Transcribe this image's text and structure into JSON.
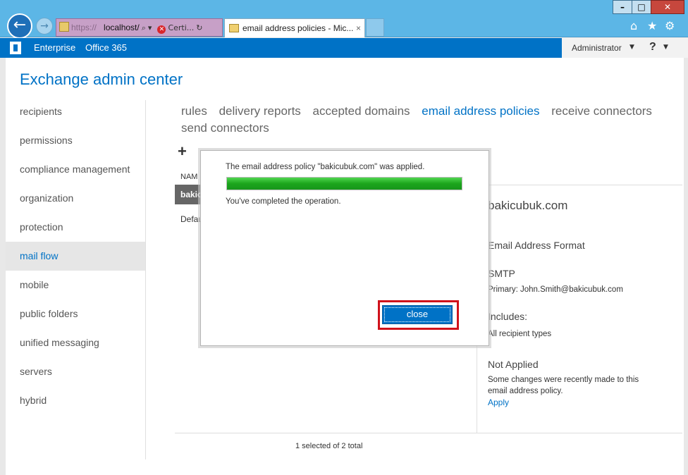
{
  "browser": {
    "address_protocol": "https://",
    "address_host": "localhost/",
    "address_search_glyph": "⌕",
    "address_dropdown_glyph": "▾",
    "cert_label": "Certi...",
    "refresh_glyph": "↻",
    "tab_title": "email address policies - Mic...",
    "tab_close": "×",
    "back_glyph": "←",
    "forward_glyph": "→",
    "home_glyph": "⌂",
    "star_glyph": "★",
    "gear_glyph": "⚙",
    "window_minimize": "–",
    "window_maximize": "□",
    "window_close": "✕"
  },
  "o365bar": {
    "enterprise": "Enterprise",
    "office365": "Office 365",
    "user": "Administrator",
    "user_caret": "▼",
    "help": "?",
    "help_caret": "▼"
  },
  "app": {
    "title": "Exchange admin center"
  },
  "sidebar": {
    "items": [
      {
        "label": "recipients"
      },
      {
        "label": "permissions"
      },
      {
        "label": "compliance management"
      },
      {
        "label": "organization"
      },
      {
        "label": "protection"
      },
      {
        "label": "mail flow",
        "active": true
      },
      {
        "label": "mobile"
      },
      {
        "label": "public folders"
      },
      {
        "label": "unified messaging"
      },
      {
        "label": "servers"
      },
      {
        "label": "hybrid"
      }
    ]
  },
  "subnav": {
    "items": [
      {
        "label": "rules"
      },
      {
        "label": "delivery reports"
      },
      {
        "label": "accepted domains"
      },
      {
        "label": "email address policies",
        "active": true
      },
      {
        "label": "receive connectors"
      },
      {
        "label": "send connectors"
      }
    ]
  },
  "toolbar": {
    "add_glyph": "+"
  },
  "list": {
    "header_name": "NAM",
    "row_selected": "bakicubuk.com",
    "row_2": "Default Policy",
    "status": "1 selected of 2 total"
  },
  "details": {
    "title": "bakicubuk.com",
    "format_heading": "Email Address Format",
    "smtp_heading": "SMTP",
    "primary": "Primary: John.Smith@bakicubuk.com",
    "includes_heading": "Includes:",
    "includes_value": "All recipient types",
    "not_applied_heading": "Not Applied",
    "not_applied_text": "Some changes were recently made to this email address policy.",
    "apply_link": "Apply"
  },
  "dialog": {
    "message": "The email address policy \"bakicubuk.com\" was applied.",
    "progress_percent": 100,
    "completed": "You've completed the operation.",
    "close_label": "close"
  },
  "colors": {
    "accent": "#0072c6",
    "progress": "#1ca51c",
    "highlight": "#d0121b"
  }
}
